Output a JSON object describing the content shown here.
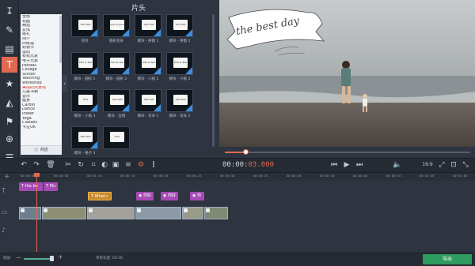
{
  "panel": {
    "title": "片头",
    "shop_label": "商店",
    "collapse_glyph": "‹"
  },
  "categories": [
    {
      "label": "全部",
      "selected": false
    },
    {
      "label": "构图"
    },
    {
      "label": "精选"
    },
    {
      "label": "爱情"
    },
    {
      "label": "婚礼"
    },
    {
      "label": "简介"
    },
    {
      "label": "问候语"
    },
    {
      "label": "购物节"
    },
    {
      "label": "运动"
    },
    {
      "label": "有机元素"
    },
    {
      "label": "电子元素"
    },
    {
      "label": "Pandas"
    },
    {
      "label": "College"
    },
    {
      "label": "School"
    },
    {
      "label": "Teaching"
    },
    {
      "label": "Workshop"
    },
    {
      "label": "美丽的风景线",
      "selected": true
    },
    {
      "label": "儿童书籍"
    },
    {
      "label": "音乐"
    },
    {
      "label": "健身"
    },
    {
      "label": "Cardio"
    },
    {
      "label": "Dance"
    },
    {
      "label": "Power"
    },
    {
      "label": "Yoga"
    },
    {
      "label": "Classes"
    },
    {
      "label": "卡拉OK"
    }
  ],
  "thumbnails": [
    {
      "label": "",
      "row": 0,
      "col": 0
    },
    {
      "label": "圆形花朵",
      "row": 0,
      "col": 1
    },
    {
      "label": "模块 - 拼图 1",
      "row": 0,
      "col": 2
    },
    {
      "label": "模块 - 拼图 2",
      "row": 0,
      "col": 3
    },
    {
      "label": "模块 - 圆形 1",
      "row": 1,
      "col": 0
    },
    {
      "label": "模块 - 圆形 2",
      "row": 1,
      "col": 1
    },
    {
      "label": "模块 - 小纸 1",
      "row": 1,
      "col": 2
    },
    {
      "label": "模块 - 小纸 2",
      "row": 1,
      "col": 3
    },
    {
      "label": "模块 - 小纸 3",
      "row": 2,
      "col": 0
    },
    {
      "label": "模块 - 丝绸",
      "row": 2,
      "col": 1
    },
    {
      "label": "模块 - 花朵 1",
      "row": 2,
      "col": 2
    },
    {
      "label": "模块 - 花朵 2",
      "row": 2,
      "col": 3
    },
    {
      "label": "模块 - 格子 3",
      "row": 3,
      "col": 0
    },
    {
      "label": "",
      "row": 3,
      "col": 1
    }
  ],
  "thumb_texts": [
    "Title Text",
    "Sam & Jane",
    "Title Text",
    "Title Text",
    "Title & Text",
    "Title & Text",
    "Title & Text",
    "Title & Text",
    "Title",
    "Title Text",
    "Title Text",
    "Title Text",
    "Title Text",
    "Title"
  ],
  "thumb_labels_top": [
    "花纹",
    "圆形花朵",
    "模块 - 拼图 1",
    "模块 - 拼图 2"
  ],
  "preview": {
    "banner_text": "the best day"
  },
  "tools": [
    {
      "icon": "import-icon",
      "glyph": "↧"
    },
    {
      "icon": "magic-wand-icon",
      "glyph": "✎"
    },
    {
      "icon": "film-strip-icon",
      "glyph": "▤"
    },
    {
      "icon": "titles-icon",
      "glyph": "T"
    },
    {
      "icon": "stickers-icon",
      "glyph": "★"
    },
    {
      "icon": "transitions-icon",
      "glyph": "◭"
    },
    {
      "icon": "motion-icon",
      "glyph": "⚑"
    },
    {
      "icon": "zoom-icon",
      "glyph": "⊕"
    },
    {
      "icon": "more-icon",
      "glyph": "☰"
    }
  ],
  "toolbar_glyphs": {
    "undo": "↶",
    "redo": "↷",
    "delete": "🗑",
    "cut": "✂",
    "rotate": "↻",
    "crop": "⌗",
    "color": "◐",
    "image": "▣",
    "audio": "≡",
    "settings": "⚙",
    "audio_meter": "⫿",
    "prev": "⏮",
    "play": "▶",
    "next": "⏭",
    "volume": "🔈",
    "aspect": "16:9",
    "fullscreen_out": "⤢",
    "snapshot": "⊡",
    "fullscreen": "⤡"
  },
  "timecode": {
    "prefix": "00:00:",
    "value": "03.000"
  },
  "ruler_ticks": [
    "00:00:00",
    "00:00:05",
    "00:00:10",
    "00:00:15",
    "00:00:20",
    "00:00:25",
    "00:00:30",
    "00:00:35",
    "00:00:40",
    "00:00:45",
    "00:00:50",
    "00:00:55",
    "00:01:00",
    "00:01:05"
  ],
  "title_track": {
    "clips": [
      {
        "label": "the be"
      },
      {
        "label": "Mu"
      }
    ]
  },
  "overlay_track": {
    "clips": [
      {
        "label": "What.r"
      },
      {
        "label": "你好"
      },
      {
        "label": "你好"
      },
      {
        "label": "你"
      }
    ]
  },
  "bottom": {
    "scale_label": "缩放:",
    "project_length_label": "项目长度:",
    "project_length_value": "00:36",
    "export_label": "导出"
  }
}
